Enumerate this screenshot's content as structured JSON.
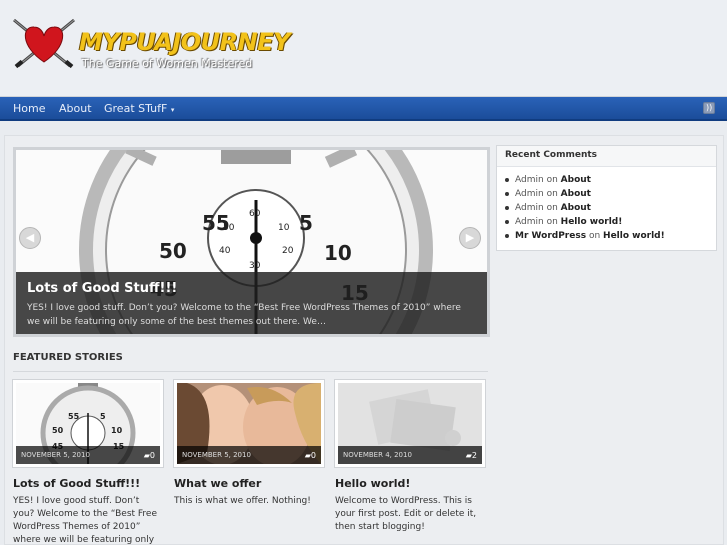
{
  "header": {
    "site_title": "MYPUAJOURNEY",
    "tagline": "The Game of Women Mastered"
  },
  "nav": {
    "items": [
      {
        "label": "Home"
      },
      {
        "label": "About"
      },
      {
        "label": "Great STufF"
      }
    ],
    "rss_icon": "rss-icon"
  },
  "slider": {
    "title": "Lots of Good Stuff!!!",
    "text": "YES! I love good stuff. Don’t you? Welcome to the “Best Free WordPress Themes of 2010” where we will be featuring only some of the best themes out there. We…",
    "prev_icon": "left-arrow-icon",
    "next_icon": "right-arrow-icon"
  },
  "sidebar": {
    "title": "Recent Comments",
    "comments": [
      {
        "author": "Admin",
        "sep": "on",
        "post": "About"
      },
      {
        "author": "Admin",
        "sep": "on",
        "post": "About"
      },
      {
        "author": "Admin",
        "sep": "on",
        "post": "About"
      },
      {
        "author": "Admin",
        "sep": "on",
        "post": "Hello world!"
      },
      {
        "author": "Mr WordPress",
        "sep": "on",
        "post": "Hello world!"
      }
    ]
  },
  "featured": {
    "heading": "FEATURED STORIES",
    "cards": [
      {
        "date": "NOVEMBER 5, 2010",
        "count": "0",
        "title": "Lots of Good Stuff!!!",
        "excerpt": "YES! I love good stuff. Don’t you? Welcome to the “Best Free WordPress Themes of 2010” where we will be featuring only some of"
      },
      {
        "date": "NOVEMBER 5, 2010",
        "count": "0",
        "title": "What we offer",
        "excerpt": "This is what we offer. Nothing!"
      },
      {
        "date": "NOVEMBER 4, 2010",
        "count": "2",
        "title": "Hello world!",
        "excerpt": "Welcome to WordPress. This is your first post. Edit or delete it, then start blogging!"
      }
    ]
  }
}
